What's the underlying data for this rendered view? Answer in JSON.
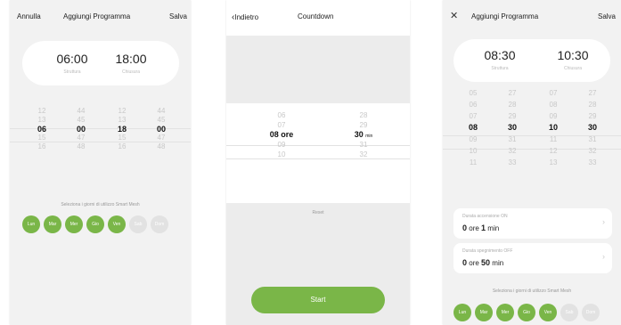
{
  "colors": {
    "accent": "#7ab648",
    "day_off": "#e2e2e2",
    "background": "#f2f2f2"
  },
  "screen1": {
    "cancel": "Annulla",
    "title": "Aggiungi Programma",
    "save": "Salva",
    "on_time": "06:00",
    "on_label": "Struttura",
    "off_time": "18:00",
    "off_label": "Chiusura",
    "picker": {
      "c1": [
        "12",
        "13",
        "06",
        "15",
        "16"
      ],
      "c2": [
        "44",
        "45",
        "00",
        "47",
        "48"
      ],
      "c3": [
        "12",
        "13",
        "18",
        "15",
        "16"
      ],
      "c4": [
        "44",
        "45",
        "00",
        "47",
        "48"
      ]
    },
    "days_note": "Seleziona i giorni di utilizzo Smart Mesh",
    "days": [
      "Lun",
      "Mar",
      "Mer",
      "Gio",
      "Ven",
      "Sab",
      "Dom"
    ],
    "days_active": [
      true,
      true,
      true,
      true,
      true,
      false,
      false
    ]
  },
  "screen2": {
    "back_icon": "chevron-left-icon",
    "back": "Indietro",
    "title": "Countdown",
    "hours": [
      "06",
      "07",
      "08",
      "09",
      "10"
    ],
    "hours_selected": "08 ore",
    "mins": [
      "28",
      "29",
      "30",
      "31",
      "32"
    ],
    "mins_selected": "30",
    "mins_unit": "min",
    "reset": "Reset",
    "start": "Start"
  },
  "screen3": {
    "close_icon": "close-icon",
    "title": "Aggiungi Programma",
    "save": "Salva",
    "on_time": "08:30",
    "on_label": "Struttura",
    "off_time": "10:30",
    "off_label": "Chiusura",
    "picker": {
      "c1": [
        "05",
        "06",
        "07",
        "08",
        "09",
        "10",
        "11"
      ],
      "c2": [
        "27",
        "28",
        "29",
        "30",
        "31",
        "32",
        "33"
      ],
      "c3": [
        "07",
        "08",
        "09",
        "10",
        "11",
        "12",
        "13"
      ],
      "c4": [
        "27",
        "28",
        "29",
        "30",
        "31",
        "32",
        "33"
      ]
    },
    "dur_on_label": "Durata accensione ON",
    "dur_on_num": "0",
    "dur_on_unit1": "ore",
    "dur_on_num2": "1",
    "dur_on_unit2": "min",
    "dur_off_label": "Durata spegnimento OFF",
    "dur_off_num": "0",
    "dur_off_unit1": "ore",
    "dur_off_num2": "50",
    "dur_off_unit2": "min",
    "days_note": "Seleziona i giorni di utilizzo Smart Mesh",
    "days": [
      "Lun",
      "Mar",
      "Mer",
      "Gio",
      "Ven",
      "Sab",
      "Dom"
    ],
    "days_active": [
      true,
      true,
      true,
      true,
      true,
      false,
      false
    ]
  }
}
